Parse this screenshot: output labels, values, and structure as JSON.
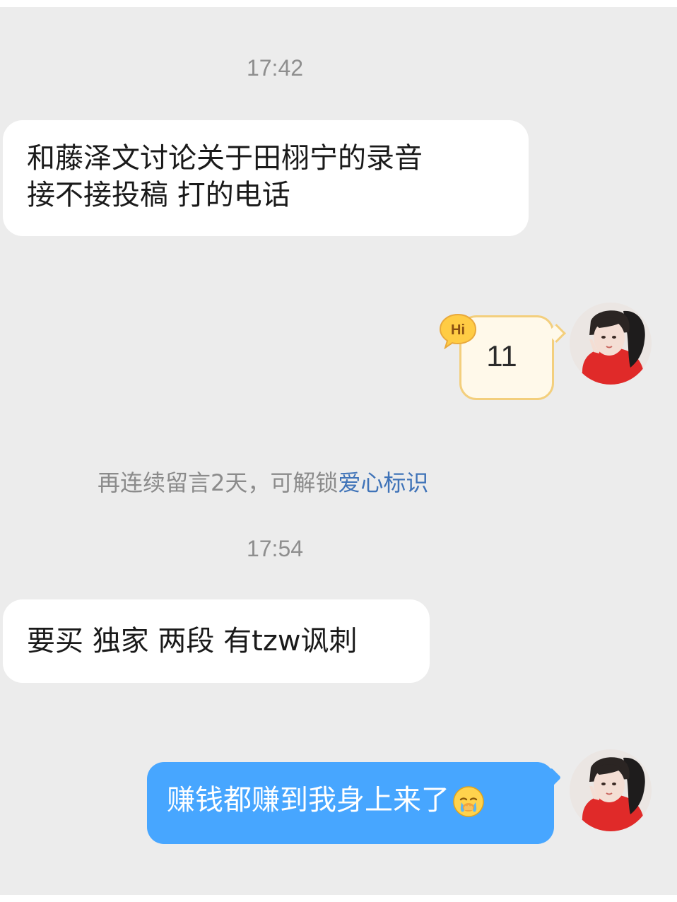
{
  "chat": {
    "time_1": "17:42",
    "message_1_line1": "和藤泽文讨论关于田栩宁的录音",
    "message_1_line2": "接不接投稿 打的电话",
    "hi_badge_text": "Hi",
    "hi_message": "11",
    "notice_text": "再连续留言2天，可解锁",
    "notice_link": "爱心标识",
    "time_2": "17:54",
    "message_3": "要买 独家  两段 有tzw讽刺",
    "message_4": "赚钱都赚到我身上来了",
    "message_4_emoji": "crying-face-emoji"
  },
  "colors": {
    "background": "#ececec",
    "incoming_bubble": "#ffffff",
    "outgoing_bubble": "#47a6ff",
    "notice_link": "#3f73b8",
    "hi_bubble_border": "#f3cf7d"
  }
}
